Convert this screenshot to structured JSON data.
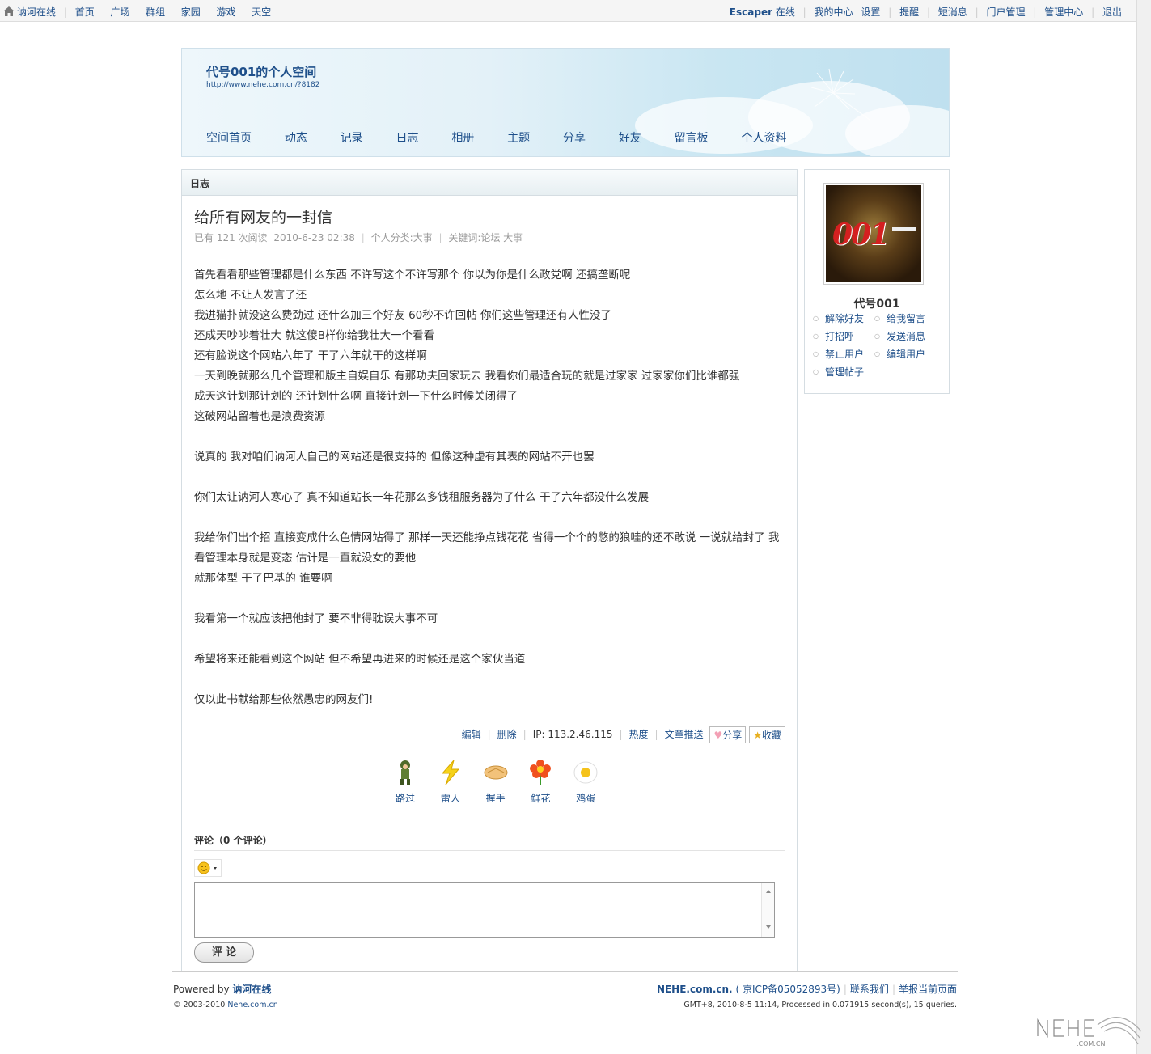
{
  "topbar": {
    "site_name": "讷河在线",
    "nav": [
      "首页",
      "广场",
      "群组",
      "家园",
      "游戏",
      "天空"
    ],
    "username": "Escaper",
    "status": "在线",
    "my_center": "我的中心",
    "settings": "设置",
    "links": [
      "提醒",
      "短消息",
      "门户管理",
      "管理中心",
      "退出"
    ]
  },
  "header": {
    "title": "代号001的个人空间",
    "url": "http://www.nehe.com.cn/?8182",
    "nav": [
      "空间首页",
      "动态",
      "记录",
      "日志",
      "相册",
      "主题",
      "分享",
      "好友",
      "留言板",
      "个人资料"
    ]
  },
  "panel": {
    "heading": "日志"
  },
  "blog": {
    "title": "给所有网友的一封信",
    "meta": {
      "reads": "已有 121 次阅读",
      "date": "2010-6-23 02:38",
      "category": "个人分类:大事",
      "keywords": "关键词:论坛  大事"
    },
    "paragraphs": [
      "首先看看那些管理都是什么东西 不许写这个不许写那个 你以为你是什么政党啊 还搞垄断呢",
      "怎么地 不让人发言了还",
      "我进猫扑就没这么费劲过 还什么加三个好友 60秒不许回帖 你们这些管理还有人性没了",
      "还成天吵吵着壮大 就这傻B样你给我壮大一个看看",
      "还有脸说这个网站六年了 干了六年就干的这样啊",
      "一天到晚就那么几个管理和版主自娱自乐 有那功夫回家玩去 我看你们最适合玩的就是过家家 过家家你们比谁都强",
      "成天这计划那计划的 还计划什么啊 直接计划一下什么时候关闭得了",
      "这破网站留着也是浪费资源",
      "",
      "说真的 我对咱们讷河人自己的网站还是很支持的 但像这种虚有其表的网站不开也罢",
      "",
      "你们太让讷河人寒心了 真不知道站长一年花那么多钱租服务器为了什么 干了六年都没什么发展",
      "",
      "我给你们出个招 直接变成什么色情网站得了 那样一天还能挣点钱花花 省得一个个的憋的狼哇的还不敢说 一说就给封了 我看管理本身就是变态 估计是一直就没女的要他",
      "就那体型 干了巴基的 谁要啊",
      "",
      "我看第一个就应该把他封了 要不非得耽误大事不可",
      "",
      "希望将来还能看到这个网站 但不希望再进来的时候还是这个家伙当道",
      "",
      "仅以此书献给那些依然愚忠的网友们!"
    ]
  },
  "actions": {
    "edit": "编辑",
    "delete": "删除",
    "ip": "IP: 113.2.46.115",
    "hot": "热度",
    "push": "文章推送",
    "share": "分享",
    "favorite": "收藏"
  },
  "reactions": [
    {
      "label": "路过",
      "icon": "soldier-icon"
    },
    {
      "label": "雷人",
      "icon": "lightning-icon"
    },
    {
      "label": "握手",
      "icon": "handshake-icon"
    },
    {
      "label": "鲜花",
      "icon": "flower-icon"
    },
    {
      "label": "鸡蛋",
      "icon": "egg-icon"
    }
  ],
  "comments": {
    "heading": "评论（0 个评论）",
    "submit": "评 论"
  },
  "sidebar": {
    "name": "代号001",
    "links": [
      "解除好友",
      "给我留言",
      "打招呼",
      "发送消息",
      "禁止用户",
      "编辑用户",
      "管理帖子"
    ]
  },
  "footer": {
    "powered_prefix": "Powered by",
    "powered_brand": "讷河在线",
    "copyright_prefix": "© 2003-2010",
    "copyright_link": "Nehe.com.cn",
    "site": "NEHE.com.cn.",
    "icp": "( 京ICP备05052893号)",
    "contact": "联系我们",
    "report": "举报当前页面",
    "stats": "GMT+8, 2010-8-5 11:14, Processed in 0.071915 second(s), 15 queries."
  },
  "colors": {
    "link": "#1e4f8a",
    "meta_gray": "#999999",
    "border": "#d5dde2",
    "header_sky": "#c9e6f2"
  }
}
